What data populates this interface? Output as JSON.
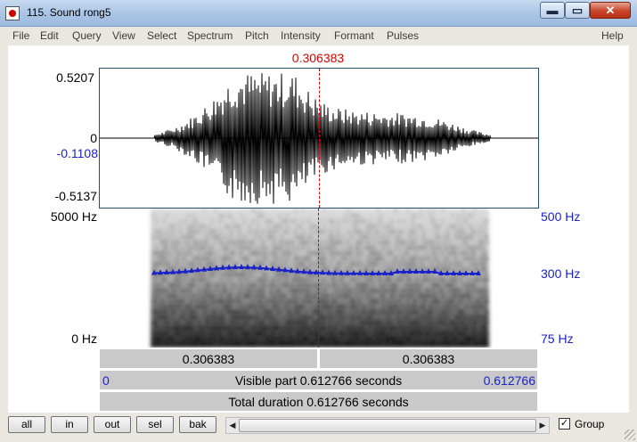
{
  "window": {
    "title": "115. Sound rong5",
    "minimize_glyph": "▬",
    "maximize_glyph": "▭",
    "close_glyph": "✕"
  },
  "menu": {
    "items": [
      "File",
      "Edit",
      "Query",
      "View",
      "Select",
      "Spectrum",
      "Pitch",
      "Intensity",
      "Formant",
      "Pulses"
    ],
    "help": "Help"
  },
  "cursor": {
    "time_label": "0.306383",
    "time": 0.306383,
    "color": "#dd0000"
  },
  "waveform": {
    "ymax_label": "0.5207",
    "zero_label": "0",
    "cursor_value_label": "-0.1108",
    "ymin_label": "-0.5137",
    "ymax": 0.5207,
    "ymin": -0.5137
  },
  "spectrogram": {
    "top_label": "5000 Hz",
    "bottom_label": "0 Hz",
    "pitch_top_label": "500 Hz",
    "pitch_mid_label": "300 Hz",
    "pitch_bottom_label": "75 Hz",
    "pitch_color": "#1b22c8"
  },
  "selection_bar": {
    "left_segment": "0.306383",
    "right_segment": "0.306383",
    "visible_start": "0",
    "visible_text": "Visible part 0.612766 seconds",
    "visible_end": "0.612766",
    "total_text": "Total duration 0.612766 seconds"
  },
  "buttons": {
    "all": "all",
    "in": "in",
    "out": "out",
    "sel": "sel",
    "bak": "bak"
  },
  "group": {
    "label": "Group",
    "checked": true,
    "check_glyph": "✓"
  },
  "scrollbar": {
    "left_arrow": "◀",
    "right_arrow": "▶"
  }
}
